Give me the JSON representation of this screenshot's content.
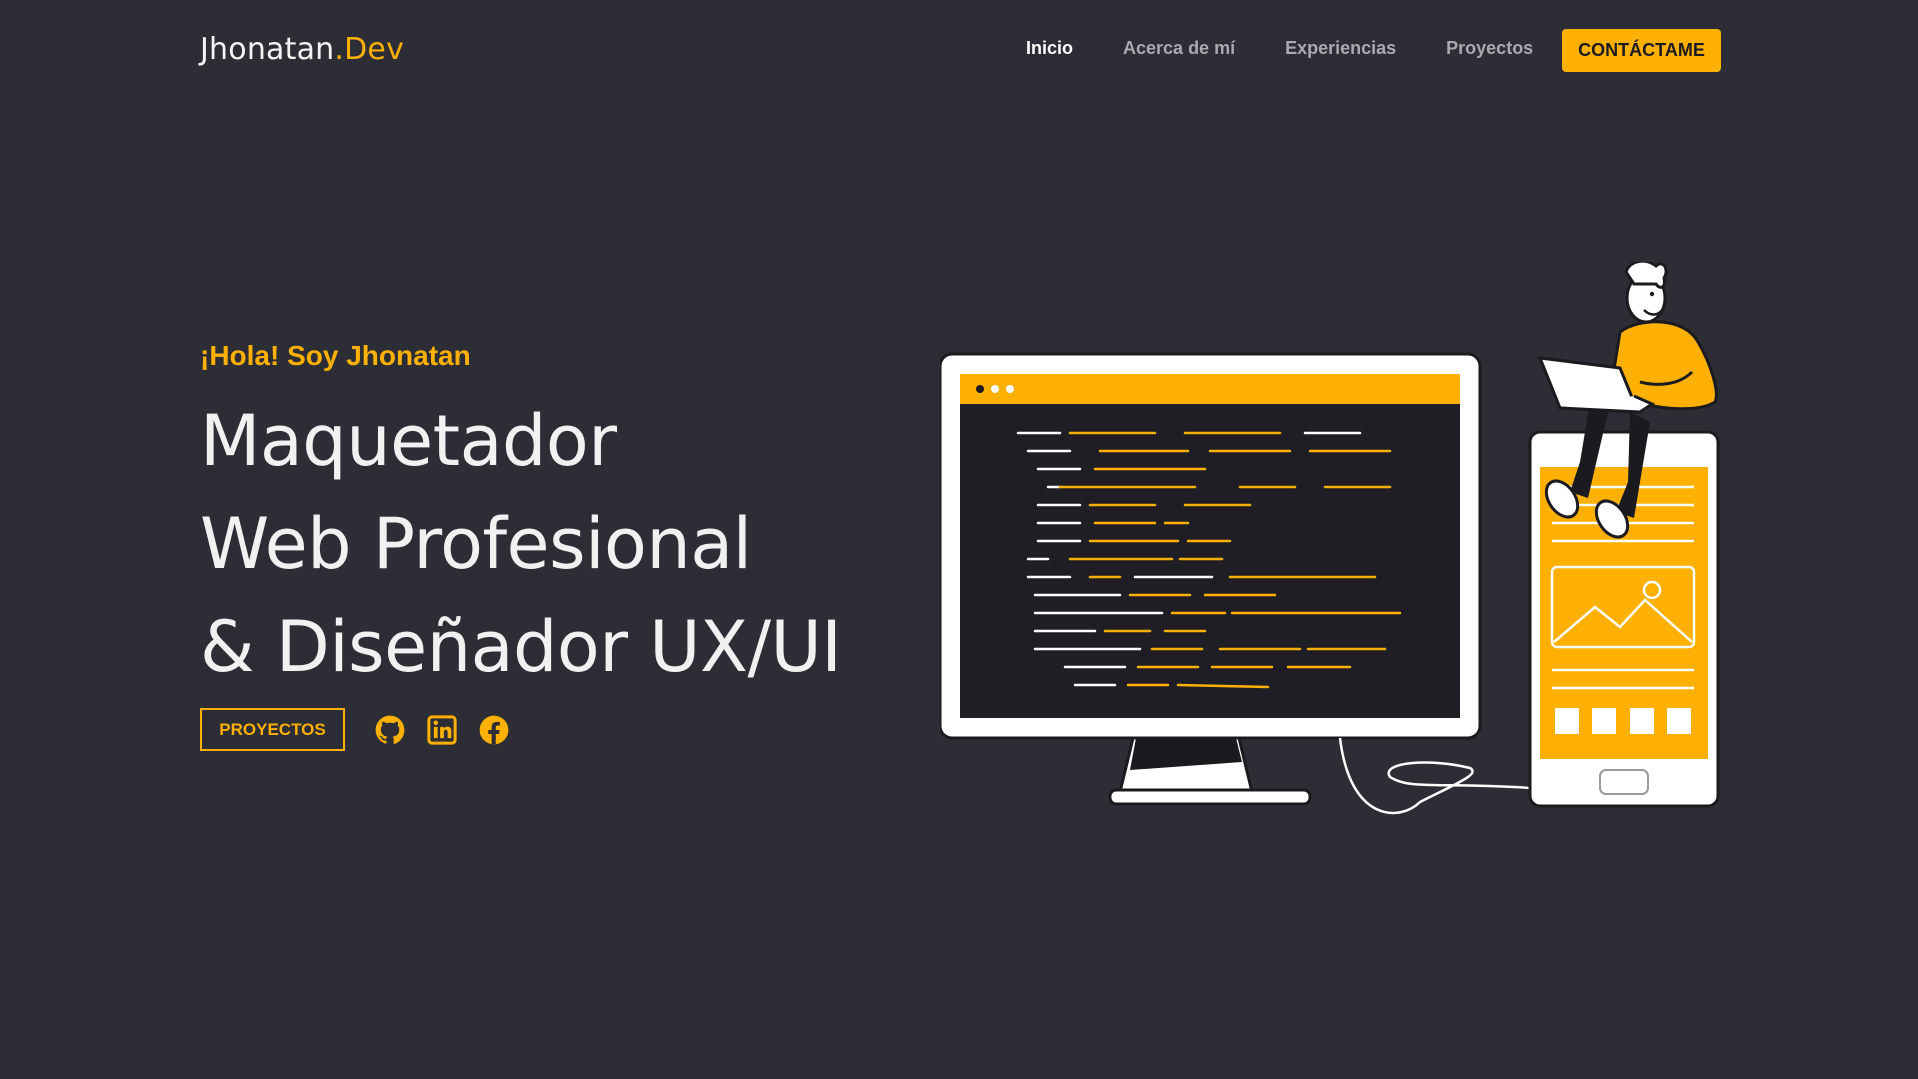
{
  "header": {
    "logo_main": "Jhonatan",
    "logo_accent": ".Dev",
    "nav": [
      {
        "label": "Inicio",
        "active": true
      },
      {
        "label": "Acerca de mí",
        "active": false
      },
      {
        "label": "Experiencias",
        "active": false
      },
      {
        "label": "Proyectos",
        "active": false
      }
    ],
    "contact_label": "CONTÁCTAME"
  },
  "hero": {
    "greeting": "¡Hola! Soy Jhonatan",
    "headline": [
      "Maquetador",
      "Web Profesional",
      "& Diseñador UX/UI"
    ],
    "projects_button": "PROYECTOS",
    "social_icons": [
      "github-icon",
      "linkedin-icon",
      "facebook-icon"
    ]
  },
  "colors": {
    "background": "#2d2d35",
    "accent": "#ffb000",
    "text": "#f1f1f1",
    "nav_inactive": "#a9a9b0"
  }
}
